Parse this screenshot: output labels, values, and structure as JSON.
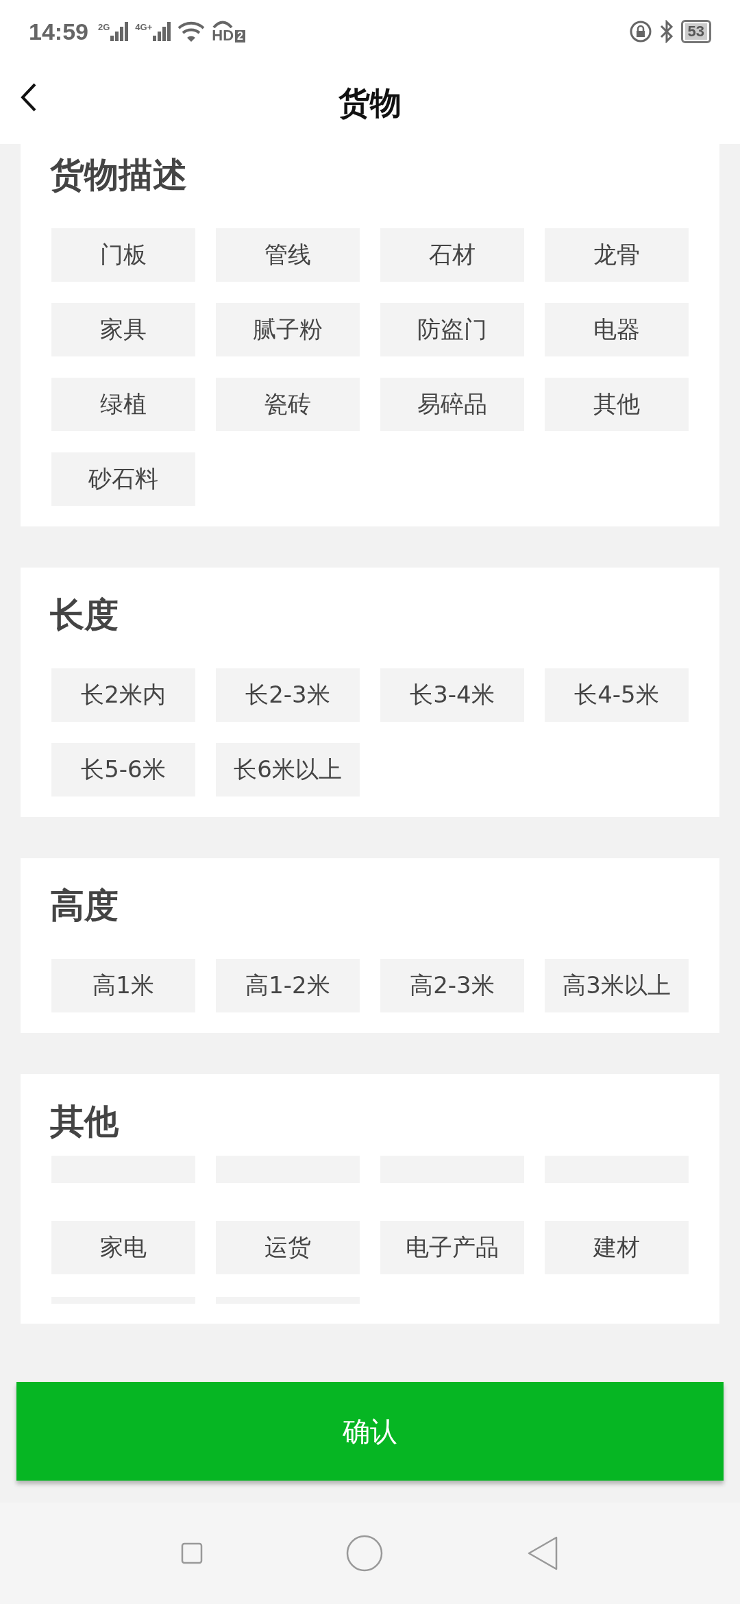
{
  "status_bar": {
    "time": "14:59",
    "signal_1": "2G",
    "signal_2": "4G+",
    "hd": "HD",
    "hd_sim": "2",
    "battery": "53"
  },
  "header": {
    "title": "货物"
  },
  "sections": [
    {
      "title": "货物描述",
      "chips": [
        {
          "label": "门板"
        },
        {
          "label": "管线"
        },
        {
          "label": "石材"
        },
        {
          "label": "龙骨"
        },
        {
          "label": "家具"
        },
        {
          "label": "腻子粉"
        },
        {
          "label": "防盗门"
        },
        {
          "label": "电器"
        },
        {
          "label": "绿植"
        },
        {
          "label": "瓷砖"
        },
        {
          "label": "易碎品"
        },
        {
          "label": "其他"
        },
        {
          "label": "砂石料"
        }
      ]
    },
    {
      "title": "长度",
      "chips": [
        {
          "label": "长2米内"
        },
        {
          "label": "长2-3米"
        },
        {
          "label": "长3-4米"
        },
        {
          "label": "长4-5米"
        },
        {
          "label": "长5-6米"
        },
        {
          "label": "长6米以上"
        }
      ]
    },
    {
      "title": "高度",
      "chips": [
        {
          "label": "高1米"
        },
        {
          "label": "高1-2米"
        },
        {
          "label": "高2-3米"
        },
        {
          "label": "高3米以上"
        }
      ]
    },
    {
      "title": "其他",
      "chips": [
        {
          "kind": "cut_top"
        },
        {
          "kind": "cut_top"
        },
        {
          "kind": "cut_top"
        },
        {
          "kind": "cut_top"
        },
        {
          "label": "家电"
        },
        {
          "label": "运货"
        },
        {
          "label": "电子产品"
        },
        {
          "label": "建材"
        },
        {
          "kind": "cut_bottom"
        },
        {
          "kind": "cut_bottom"
        }
      ]
    }
  ],
  "confirm_button": "确认"
}
